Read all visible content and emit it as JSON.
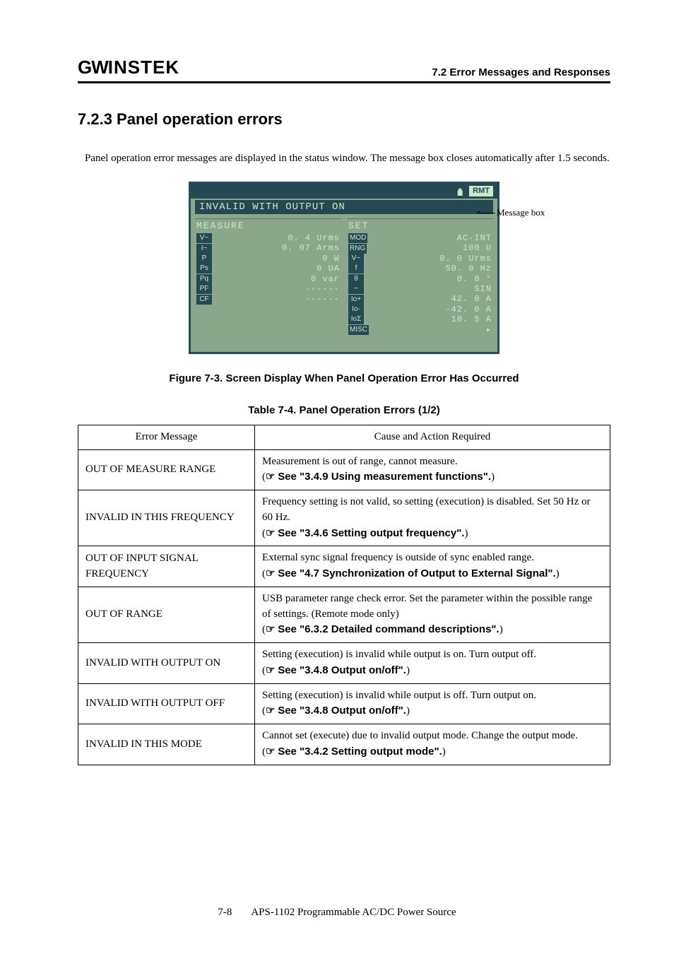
{
  "header": {
    "brand_gw": "GW",
    "brand_instek": "INSTEK",
    "chapter_ref": "7.2 Error Messages and Responses"
  },
  "section": {
    "heading": "7.2.3   Panel operation errors",
    "intro": "Panel operation error messages are displayed in the status window.  The message  box closes automatically after 1.5 seconds."
  },
  "panel": {
    "rmt": "RMT",
    "message": "INVALID WITH OUTPUT ON",
    "callout": "Message box",
    "measure_hdr": "MEASURE",
    "set_hdr": "SET",
    "measure_rows": [
      {
        "tag": "V~",
        "val": "0. 4 Urms"
      },
      {
        "tag": "I~",
        "val": "0. 07 Arms"
      },
      {
        "tag": "P",
        "val": "0 W"
      },
      {
        "tag": "Ps",
        "val": "0 UA"
      },
      {
        "tag": "Pq",
        "val": "0 var"
      },
      {
        "tag": "PF",
        "val": "------"
      },
      {
        "tag": "CF",
        "val": "------"
      }
    ],
    "set_rows": [
      {
        "tag": "MOD",
        "val": "AC-INT"
      },
      {
        "tag": "RNG",
        "val": "100 U"
      },
      {
        "tag": "V~",
        "val": "0. 0 Urms"
      },
      {
        "tag": "f",
        "val": "50. 0 Hz"
      },
      {
        "tag": "θ",
        "val": "0. 0 °"
      },
      {
        "tag": "~",
        "val": "SIN"
      },
      {
        "tag": "Io+",
        "val": "42. 0 A"
      },
      {
        "tag": "Io-",
        "val": "-42. 0 A"
      },
      {
        "tag": "IoΣ",
        "val": "10. 5 A"
      },
      {
        "tag": "MISC",
        "val": "▸"
      }
    ]
  },
  "figure_caption": "Figure 7-3.  Screen Display When Panel Operation Error Has Occurred",
  "table_caption": "Table 7-4.  Panel Operation Errors (1/2)",
  "table": {
    "headers": {
      "msg": "Error Message",
      "cause": "Cause and Action Required"
    },
    "rows": [
      {
        "msg": "OUT OF MEASURE RANGE",
        "desc": "Measurement is out of range, cannot measure.",
        "ref": "See \"3.4.9  Using measurement functions\"."
      },
      {
        "msg": "INVALID IN THIS FREQUENCY",
        "desc": "Frequency setting is not valid, so setting (execution) is disabled.  Set 50 Hz or 60 Hz.",
        "ref": "See \"3.4.6  Setting output frequency\"."
      },
      {
        "msg": "OUT OF INPUT SIGNAL FREQUENCY",
        "desc": "External sync signal frequency is outside of sync enabled range.",
        "ref": "See \"4.7  Synchronization of Output to External Signal\"."
      },
      {
        "msg": "OUT OF RANGE",
        "desc": "USB parameter range check error.  Set the parameter within the possible range of settings.  (Remote mode only)",
        "ref": "See \"6.3.2  Detailed command descriptions\"."
      },
      {
        "msg": "INVALID WITH OUTPUT ON",
        "desc": "Setting (execution) is invalid while output is on.   Turn output off.",
        "ref": "See \"3.4.8  Output on/off\"."
      },
      {
        "msg": "INVALID WITH OUTPUT OFF",
        "desc": "Setting (execution) is invalid while output is off.   Turn output on.",
        "ref": "See \"3.4.8  Output on/off\"."
      },
      {
        "msg": "INVALID IN THIS MODE",
        "desc": "Cannot set (execute) due to invalid output mode.   Change the output mode.",
        "ref": "See \"3.4.2  Setting output mode\"."
      }
    ]
  },
  "footer": {
    "page": "7-8",
    "doc": "APS-1102 Programmable AC/DC Power Source"
  }
}
